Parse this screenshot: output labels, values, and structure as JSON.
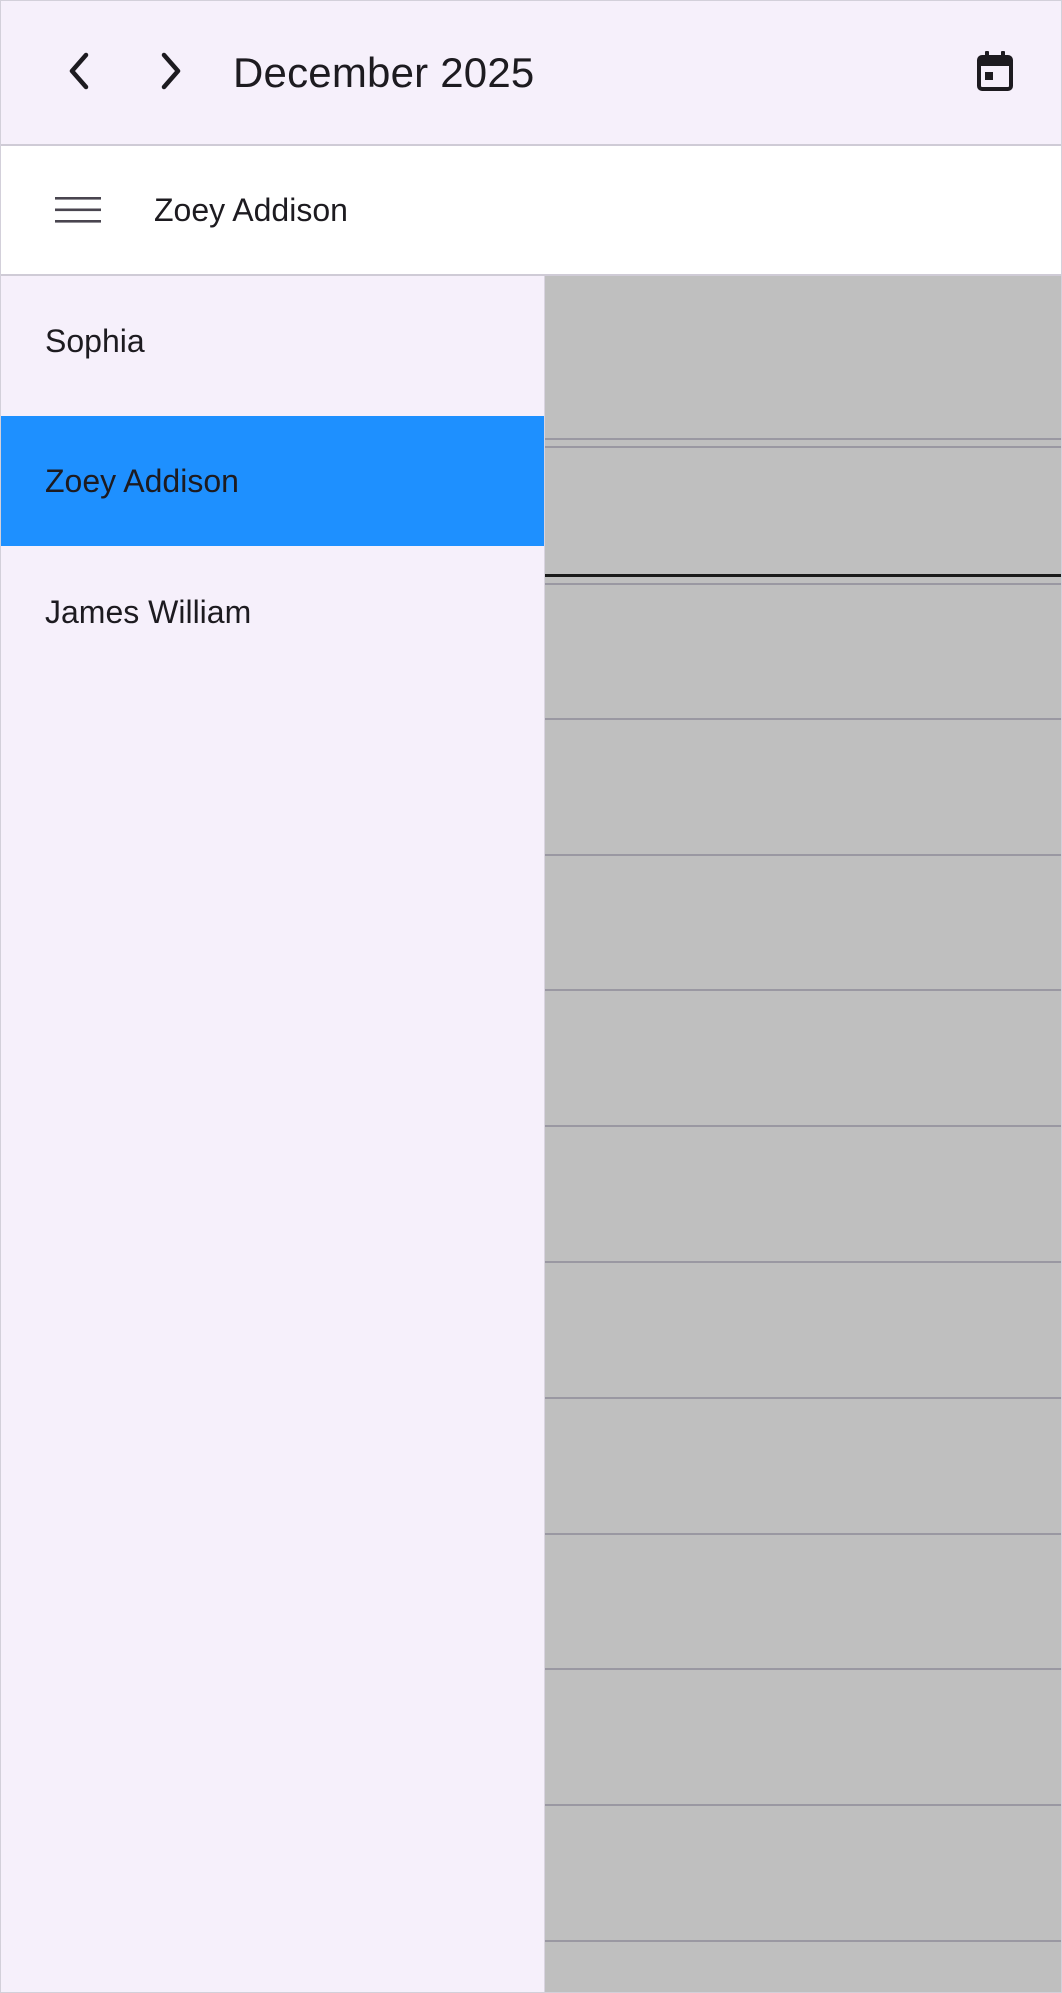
{
  "header": {
    "title": "December 2025",
    "prev_icon": "chevron-left-icon",
    "next_icon": "chevron-right-icon",
    "today_icon": "calendar-today-icon"
  },
  "resource_bar": {
    "menu_icon": "menu-icon",
    "current_resource": "Zoey Addison"
  },
  "drawer": {
    "items": [
      {
        "label": "Sophia",
        "selected": false
      },
      {
        "label": "Zoey Addison",
        "selected": true
      },
      {
        "label": "James William",
        "selected": false
      }
    ]
  },
  "colors": {
    "header_bg": "#f6f0fb",
    "drawer_bg": "#f6f0fb",
    "selected_bg": "#1e90ff",
    "scrim": "#bfbfbf",
    "text": "#1d1b20"
  }
}
